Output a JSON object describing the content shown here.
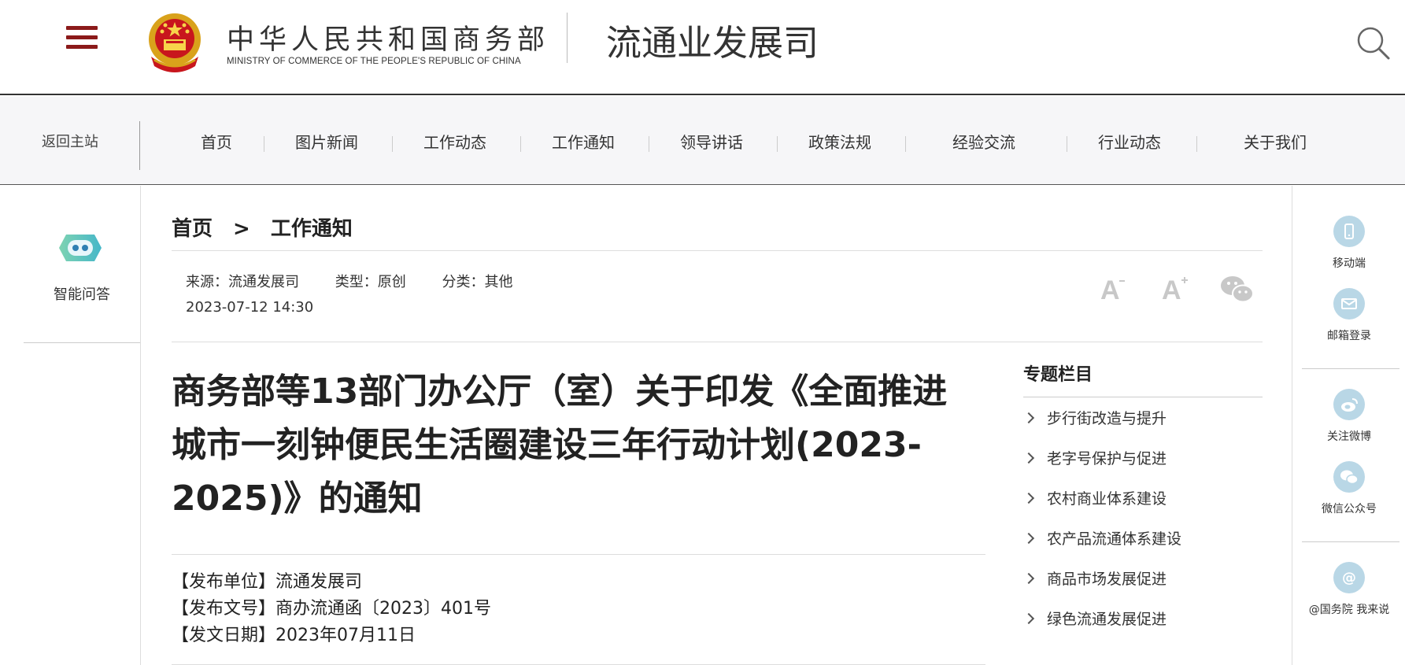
{
  "header": {
    "ministry_cn": "中华人民共和国商务部",
    "ministry_en": "MINISTRY OF COMMERCE OF THE PEOPLE'S REPUBLIC OF CHINA",
    "dept_title": "流通业发展司",
    "menu_icon": "hamburger-menu-icon",
    "search_icon": "search-icon"
  },
  "nav": {
    "back_home": "返回主站",
    "items": [
      "首页",
      "图片新闻",
      "工作动态",
      "工作通知",
      "领导讲话",
      "政策法规",
      "经验交流",
      "行业动态",
      "关于我们"
    ]
  },
  "left_sidebar": {
    "qa_label": "智能问答",
    "qa_icon": "robot-icon"
  },
  "breadcrumb": {
    "home": "首页",
    "separator": ">",
    "current": "工作通知"
  },
  "meta": {
    "source": "来源：流通发展司",
    "type": "类型：原创",
    "category": "分类：其他",
    "datetime": "2023-07-12 14:30"
  },
  "tools": {
    "font_decrease": "A",
    "font_increase": "A",
    "wechat_icon": "wechat-share-icon"
  },
  "article": {
    "title": "商务部等13部门办公厅（室）关于印发《全面推进城市一刻钟便民生活圈建设三年行动计划(2023-2025)》的通知",
    "publisher": "【发布单位】流通发展司",
    "doc_number": "【发布文号】商办流通函〔2023〕401号",
    "issue_date": "【发文日期】2023年07月11日"
  },
  "topics": {
    "title": "专题栏目",
    "items": [
      "步行街改造与提升",
      "老字号保护与促进",
      "农村商业体系建设",
      "农产品流通体系建设",
      "商品市场发展促进",
      "绿色流通发展促进"
    ]
  },
  "right_sidebar": {
    "items": [
      {
        "label": "移动端",
        "icon": "mobile-icon"
      },
      {
        "label": "邮箱登录",
        "icon": "mail-icon"
      },
      {
        "label": "关注微博",
        "icon": "weibo-icon"
      },
      {
        "label": "微信公众号",
        "icon": "wechat-icon"
      },
      {
        "label": "@国务院 我来说",
        "icon": "at-icon"
      }
    ]
  },
  "colors": {
    "brand_red": "#8b1a1a",
    "nav_bg": "#f6f6f8",
    "icon_blue": "#b9d7e6",
    "qa_green": "#5ec7a8"
  }
}
